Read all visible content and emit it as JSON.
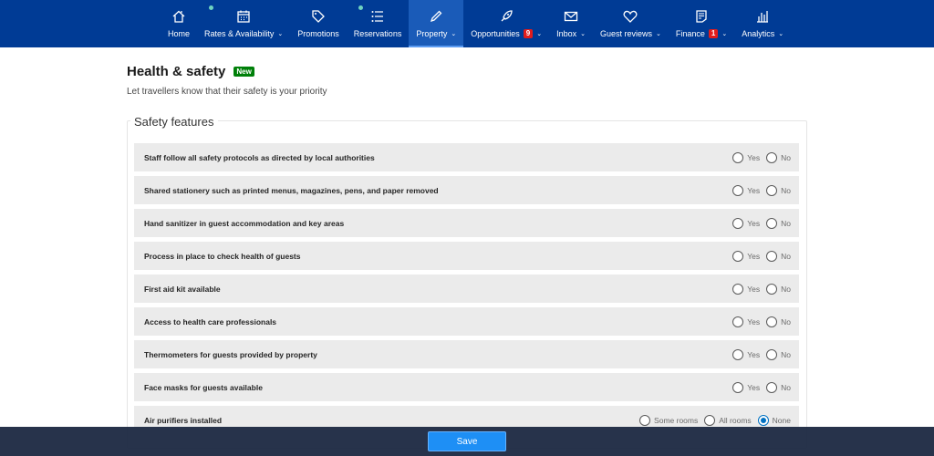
{
  "nav": {
    "items": [
      {
        "label": "Home",
        "icon": "home-icon",
        "chevron": false
      },
      {
        "label": "Rates & Availability",
        "icon": "calendar-icon",
        "chevron": true,
        "dot": true
      },
      {
        "label": "Promotions",
        "icon": "tag-icon",
        "chevron": false
      },
      {
        "label": "Reservations",
        "icon": "list-icon",
        "chevron": false,
        "dot": true
      },
      {
        "label": "Property",
        "icon": "pencil-icon",
        "chevron": true,
        "active": true
      },
      {
        "label": "Opportunities",
        "icon": "rocket-icon",
        "chevron": true,
        "badge": "9"
      },
      {
        "label": "Inbox",
        "icon": "envelope-icon",
        "chevron": true
      },
      {
        "label": "Guest reviews",
        "icon": "heart-icon",
        "chevron": true
      },
      {
        "label": "Finance",
        "icon": "document-icon",
        "chevron": true,
        "badge": "1"
      },
      {
        "label": "Analytics",
        "icon": "bar-chart-icon",
        "chevron": true
      }
    ],
    "chevron_glyph": "⌄"
  },
  "page": {
    "title": "Health & safety",
    "new_badge": "New",
    "subtitle": "Let travellers know that their safety is your priority"
  },
  "section": {
    "legend": "Safety features",
    "rows": [
      {
        "label": "Staff follow all safety protocols as directed by local authorities",
        "options": [
          "Yes",
          "No"
        ],
        "selected": null
      },
      {
        "label": "Shared stationery such as printed menus, magazines, pens, and paper removed",
        "options": [
          "Yes",
          "No"
        ],
        "selected": null
      },
      {
        "label": "Hand sanitizer in guest accommodation and key areas",
        "options": [
          "Yes",
          "No"
        ],
        "selected": null
      },
      {
        "label": "Process in place to check health of guests",
        "options": [
          "Yes",
          "No"
        ],
        "selected": null
      },
      {
        "label": "First aid kit available",
        "options": [
          "Yes",
          "No"
        ],
        "selected": null
      },
      {
        "label": "Access to health care professionals",
        "options": [
          "Yes",
          "No"
        ],
        "selected": null
      },
      {
        "label": "Thermometers for guests provided by property",
        "options": [
          "Yes",
          "No"
        ],
        "selected": null
      },
      {
        "label": "Face masks for guests available",
        "options": [
          "Yes",
          "No"
        ],
        "selected": null
      },
      {
        "label": "Air purifiers installed",
        "options": [
          "Some rooms",
          "All rooms",
          "None"
        ],
        "selected": "None"
      }
    ]
  },
  "footer": {
    "save_label": "Save"
  },
  "colors": {
    "nav_bg": "#003b95",
    "accent": "#1e8ff5",
    "badge_red": "#e21c1c",
    "new_green": "#008009"
  }
}
